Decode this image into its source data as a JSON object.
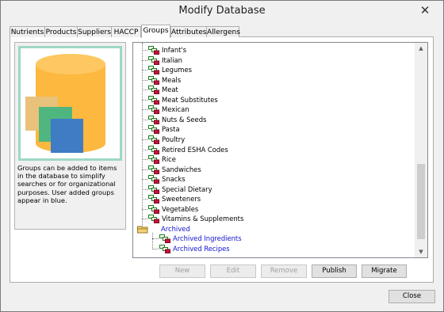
{
  "window": {
    "title": "Modify Database",
    "close_glyph": "✕"
  },
  "tabs": [
    {
      "label": "Nutrients",
      "active": false
    },
    {
      "label": "Products",
      "active": false
    },
    {
      "label": "Suppliers",
      "active": false
    },
    {
      "label": "HACCP",
      "active": false
    },
    {
      "label": "Groups",
      "active": true
    },
    {
      "label": "Attributes",
      "active": false
    },
    {
      "label": "Allergens",
      "active": false
    }
  ],
  "info": {
    "icon": "database-groups-icon",
    "text": "Groups can be added to items in the database to simplify searches or for organizational purposes. User added groups appear in blue."
  },
  "tree": {
    "items": [
      {
        "label": "Infant's",
        "user_added": false
      },
      {
        "label": "Italian",
        "user_added": false
      },
      {
        "label": "Legumes",
        "user_added": false
      },
      {
        "label": "Meals",
        "user_added": false
      },
      {
        "label": "Meat",
        "user_added": false
      },
      {
        "label": "Meat Substitutes",
        "user_added": false
      },
      {
        "label": "Mexican",
        "user_added": false
      },
      {
        "label": "Nuts & Seeds",
        "user_added": false
      },
      {
        "label": "Pasta",
        "user_added": false
      },
      {
        "label": "Poultry",
        "user_added": false
      },
      {
        "label": "Retired ESHA Codes",
        "user_added": false
      },
      {
        "label": "Rice",
        "user_added": false
      },
      {
        "label": "Sandwiches",
        "user_added": false
      },
      {
        "label": "Snacks",
        "user_added": false
      },
      {
        "label": "Special Dietary",
        "user_added": false
      },
      {
        "label": "Sweeteners",
        "user_added": false
      },
      {
        "label": "Vegetables",
        "user_added": false
      },
      {
        "label": "Vitamins & Supplements",
        "user_added": false
      }
    ],
    "archived": {
      "label": "Archived",
      "expanded": true,
      "children": [
        {
          "label": "Archived Ingredients"
        },
        {
          "label": "Archived Recipes"
        }
      ]
    },
    "scroll_up_glyph": "▲",
    "scroll_down_glyph": "▼"
  },
  "actions": {
    "new": "New",
    "edit": "Edit",
    "remove": "Remove",
    "publish": "Publish",
    "migrate": "Migrate"
  },
  "footer": {
    "close": "Close"
  },
  "colors": {
    "user_added_text": "#1010d0",
    "cylinder": "#fdb83f",
    "card_tan": "#e8c27a",
    "card_green": "#4fb67f",
    "card_blue": "#3f7cc4",
    "frame": "#9ed7c5"
  }
}
